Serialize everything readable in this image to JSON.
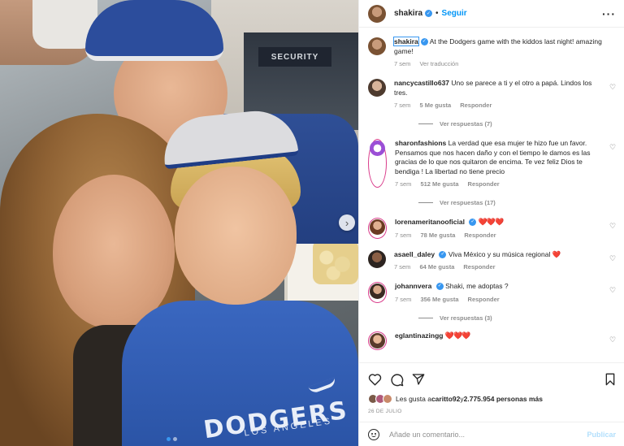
{
  "post": {
    "photo_overlay_text": {
      "security_sign": "SECURITY",
      "jersey_big": "DODGERS",
      "jersey_small": "LOS ANGELES"
    },
    "carousel_next": "›"
  },
  "header": {
    "username": "shakira",
    "separator": "•",
    "follow_label": "Seguir",
    "more_label": "···"
  },
  "caption": {
    "username": "shakira",
    "text": "At the Dodgers game with the kiddos last night! amazing game!",
    "time": "7 sem",
    "translate_label": "Ver traducción"
  },
  "comments": [
    {
      "username": "nancycastillo637",
      "text": "Uno se parece a ti y el otro a papá. Lindos los tres.",
      "time": "7 sem",
      "likes": "5 Me gusta",
      "reply_label": "Responder",
      "replies": "Ver respuestas (7)"
    },
    {
      "username": "sharonfashions",
      "text": "La verdad que esa mujer te hizo fue un favor. Pensamos que nos hacen daño y con el tiempo le damos es las gracias de lo que nos quitaron de encima. Te vez feliz Dios te bendiga ! La libertad no tiene precio",
      "time": "7 sem",
      "likes": "512 Me gusta",
      "reply_label": "Responder",
      "replies": "Ver respuestas (17)"
    },
    {
      "username": "lorenameritanooficial",
      "text": "❤️❤️❤️",
      "time": "7 sem",
      "likes": "78 Me gusta",
      "reply_label": "Responder"
    },
    {
      "username": "asaell_daley",
      "text": "Viva México y su música regional ❤️",
      "time": "7 sem",
      "likes": "64 Me gusta",
      "reply_label": "Responder"
    },
    {
      "username": "johannvera",
      "text": "Shaki, me adoptas ?",
      "time": "7 sem",
      "likes": "356 Me gusta",
      "reply_label": "Responder",
      "replies": "Ver respuestas (3)"
    },
    {
      "username": "eglantinazingg",
      "text": "❤️❤️❤️"
    }
  ],
  "actions": {
    "likes_prefix": "Les gusta a ",
    "likes_user": "caritto92",
    "likes_mid": " y ",
    "likes_count": "2.775.954 personas más",
    "date": "26 DE JULIO"
  },
  "add_comment": {
    "placeholder": "Añade un comentario...",
    "publish_label": "Publicar"
  },
  "colors": {
    "accent": "#0095f6",
    "heart": "#ed1c24",
    "muted": "#8e8e8e"
  }
}
